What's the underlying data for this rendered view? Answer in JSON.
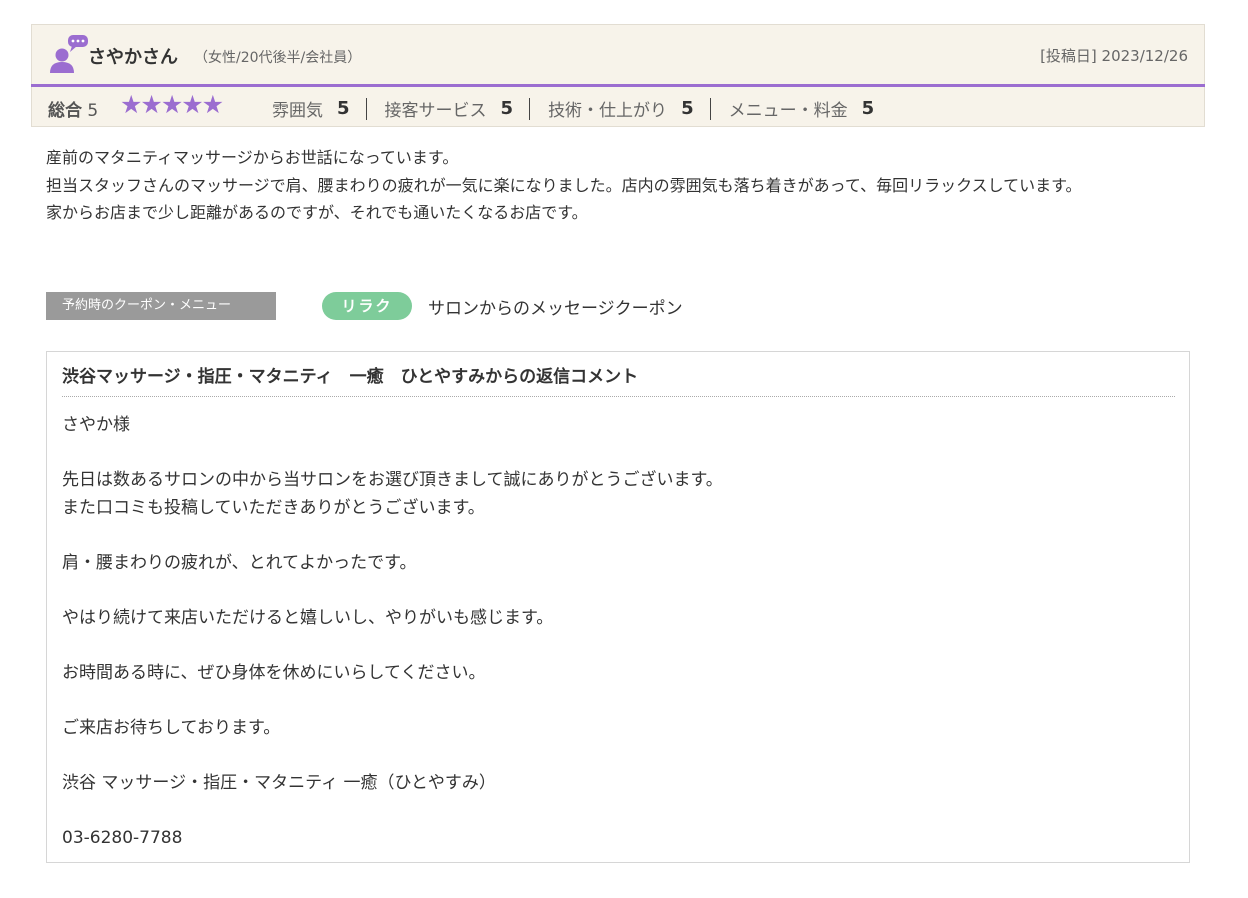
{
  "review": {
    "reviewer_name": "さやかさん",
    "reviewer_profile": "（女性/20代後半/会社員）",
    "post_date": "[投稿日] 2023/12/26",
    "overall_label": "総合",
    "overall_value": "5",
    "stars": "★★★★★",
    "star_rating": 5,
    "star_color": "#9b6dd0",
    "sub_ratings": [
      {
        "label": "雰囲気",
        "value": "5"
      },
      {
        "label": "接客サービス",
        "value": "5"
      },
      {
        "label": "技術・仕上がり",
        "value": "5"
      },
      {
        "label": "メニュー・料金",
        "value": "5"
      }
    ],
    "body_lines": [
      "産前のマタニティマッサージからお世話になっています。",
      "担当スタッフさんのマッサージで肩、腰まわりの疲れが一気に楽になりました。店内の雰囲気も落ち着きがあって、毎回リラックスしています。",
      "家からお店まで少し距離があるのですが、それでも通いたくなるお店です。"
    ]
  },
  "coupon": {
    "label": "予約時のクーポン・メニュー",
    "badge": "リラク",
    "badge_color": "#7ecc9a",
    "name": "サロンからのメッセージクーポン"
  },
  "reply": {
    "title": "渋谷マッサージ・指圧・マタニティ　一癒　ひとやすみからの返信コメント",
    "paragraphs": [
      [
        "さやか様"
      ],
      [
        "先日は数あるサロンの中から当サロンをお選び頂きまして誠にありがとうございます。",
        "また口コミも投稿していただきありがとうございます。"
      ],
      [
        "肩・腰まわりの疲れが、とれてよかったです。"
      ],
      [
        "やはり続けて来店いただけると嬉しいし、やりがいも感じます。"
      ],
      [
        "お時間ある時に、ぜひ身体を休めにいらしてください。"
      ],
      [
        "ご来店お待ちしております。"
      ],
      [
        "渋谷 マッサージ・指圧・マタニティ 一癒（ひとやすみ）"
      ],
      [
        "03-6280-7788"
      ]
    ]
  },
  "icons": {
    "avatar": "user-speech-bubble-icon",
    "accent_color": "#9b6dd0"
  }
}
